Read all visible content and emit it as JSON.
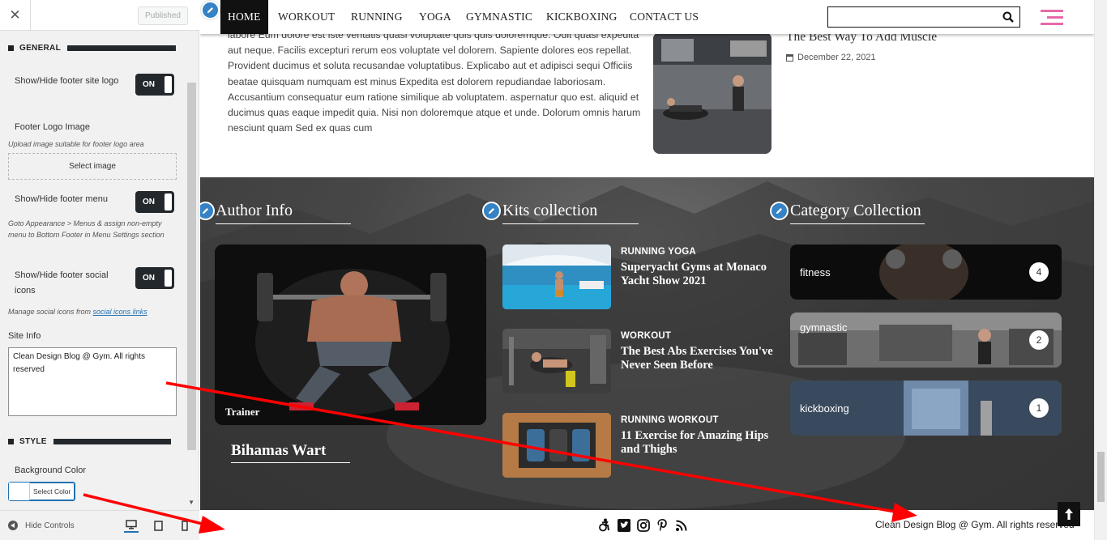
{
  "sidebar": {
    "close_label": "✕",
    "published_label": "Published",
    "sections": {
      "general": "GENERAL",
      "style": "STYLE"
    },
    "controls": {
      "footer_logo_label": "Show/Hide footer site logo",
      "footer_logo_toggle": "ON",
      "footer_logo_image_label": "Footer Logo Image",
      "footer_logo_image_desc": "Upload image suitable for footer logo area",
      "select_image_label": "Select image",
      "footer_menu_label": "Show/Hide footer menu",
      "footer_menu_toggle": "ON",
      "footer_menu_desc": "Goto Appearance > Menus & assign non-empty menu to Bottom Footer in Menu Settings section",
      "footer_social_label": "Show/Hide footer social icons",
      "footer_social_toggle": "ON",
      "footer_social_desc_prefix": "Manage social icons from ",
      "footer_social_desc_link": "social icons links",
      "site_info_label": "Site Info",
      "site_info_value": "Clean Design Blog @ Gym. All rights reserved",
      "bg_color_label": "Background Color",
      "select_color_label": "Select Color"
    },
    "footer": {
      "hide_controls": "Hide Controls"
    }
  },
  "nav": {
    "items": [
      "HOME",
      "WORKOUT",
      "RUNNING",
      "YOGA",
      "GYMNASTIC",
      "KICKBOXING",
      "CONTACT US"
    ],
    "search_placeholder": ""
  },
  "article": {
    "text": "labore Eum dolore est iste veritatis quasi voluptate quis quis doloremque. Odit quasi expedita aut neque. Facilis excepturi rerum eos voluptate vel dolorem. Sapiente dolores eos repellat. Provident ducimus et soluta recusandae voluptatibus. Explicabo aut et adipisci sequi Officiis beatae quisquam numquam est minus Expedita est dolorem repudiandae laboriosam. Accusantium consequatur eum ratione similique ab voluptatem. aspernatur quo est. aliquid et ducimus quas eaque impedit quia. Nisi non doloremque atque et unde. Dolorum omnis harum nesciunt quam Sed ex quas cum"
  },
  "recent_post": {
    "title": "The Best Way To Add Muscle",
    "date": "December 22, 2021"
  },
  "footer_widgets": {
    "author": {
      "title": "Author Info",
      "role": "Trainer",
      "name": "Bihamas Wart"
    },
    "kits": {
      "title": "Kits collection",
      "posts": [
        {
          "categories": "RUNNING  YOGA",
          "title": "Superyacht Gyms at Monaco Yacht Show 2021"
        },
        {
          "categories": "WORKOUT",
          "title": "The Best Abs Exercises You've Never Seen Before"
        },
        {
          "categories": "RUNNING  WORKOUT",
          "title": "11 Exercise for Amazing Hips and Thighs"
        }
      ]
    },
    "categories": {
      "title": "Category Collection",
      "items": [
        {
          "name": "fitness",
          "count": "4"
        },
        {
          "name": "gymnastic",
          "count": "2"
        },
        {
          "name": "kickboxing",
          "count": "1"
        }
      ]
    }
  },
  "bottom_bar": {
    "copyright": "Clean Design Blog @ Gym. All rights reserved"
  },
  "colors": {
    "accent_pink": "#e66aa8",
    "edit_blue": "#3582c4",
    "toggle_dark": "#23282d",
    "annotation_red": "#ff0000"
  }
}
